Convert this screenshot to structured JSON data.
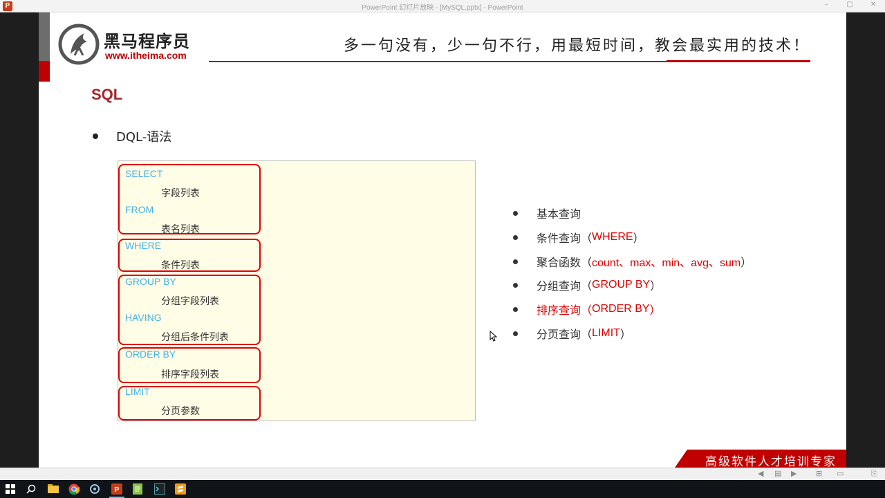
{
  "window": {
    "title": "PowerPoint 幻灯片放映 - [MySQL.pptx] - PowerPoint",
    "controls": [
      "–",
      "▢",
      "✕"
    ]
  },
  "slide": {
    "logo": {
      "brand": "黑马程序员",
      "url": "www.itheima.com"
    },
    "slogan": "多一句没有，少一句不行，用最短时间，教会最实用的技术！",
    "section_title": "SQL",
    "main_bullet": "DQL-语法",
    "clauses": [
      {
        "lines": [
          {
            "kw": "SELECT"
          },
          {
            "val": "字段列表"
          },
          {
            "kw": "FROM"
          },
          {
            "val": "表名列表"
          }
        ]
      },
      {
        "lines": [
          {
            "kw": "WHERE"
          },
          {
            "val": "条件列表"
          }
        ]
      },
      {
        "lines": [
          {
            "kw": "GROUP  BY"
          },
          {
            "val": "分组字段列表"
          },
          {
            "kw": "HAVING"
          },
          {
            "val": "分组后条件列表"
          }
        ]
      },
      {
        "lines": [
          {
            "kw": "ORDER BY"
          },
          {
            "val": "排序字段列表"
          }
        ]
      },
      {
        "lines": [
          {
            "kw": "LIMIT"
          },
          {
            "val": "分页参数"
          }
        ]
      }
    ],
    "topics": [
      {
        "text": "基本查询",
        "suffix": ""
      },
      {
        "text": "条件查询（",
        "red": "WHERE",
        "suffix": "）"
      },
      {
        "text": "聚合函数（",
        "red": "count、max、min、avg、sum",
        "suffix": "）"
      },
      {
        "text": "分组查询（",
        "red": "GROUP BY",
        "suffix": "）"
      },
      {
        "text": "排序查询（",
        "red": "ORDER BY",
        "suffix": "）",
        "active": true
      },
      {
        "text": "分页查询（",
        "red": "LIMIT",
        "suffix": "）"
      }
    ],
    "banner": "高级软件人才培训专家"
  },
  "colors": {
    "accent_red": "#c00000",
    "keyword_blue": "#43b2e8",
    "panel_bg": "#fffde6"
  },
  "presenter_controls": [
    "◀",
    "▤",
    "▶",
    "⊞",
    "▭",
    "⎘"
  ],
  "taskbar": {
    "icons": [
      "windows-start-icon",
      "search-icon",
      "file-explorer-icon",
      "chrome-icon",
      "app-icon",
      "powerpoint-icon",
      "notepad-icon",
      "terminal-icon",
      "sublime-icon"
    ]
  }
}
